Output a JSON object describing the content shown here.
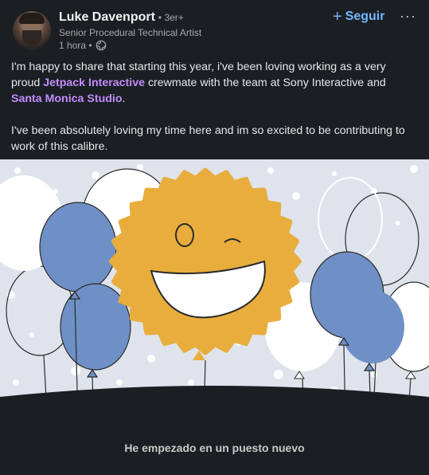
{
  "author": {
    "name": "Luke Davenport",
    "degree": "• 3er+",
    "headline": "Senior Procedural Technical Artist",
    "time": "1 hora •"
  },
  "actions": {
    "follow_label": "Seguir",
    "more_label": "···"
  },
  "post": {
    "p1": {
      "t1": "I'm happy to share that starting this year, i've been loving working as a very proud ",
      "m1": "Jetpack Interactive",
      "t2": " crewmate with the team at Sony Interactive and ",
      "m2": "Santa Monica Studio",
      "t3": "."
    },
    "p2": "I've been absolutely loving my time here and im so excited to be contributing to work of this calibre."
  },
  "image": {
    "caption": "He empezado en un puesto nuevo"
  },
  "colors": {
    "background": "#1b1f23",
    "link": "#71b7fb",
    "mention": "#c38bff",
    "sun": "#e8ad3d",
    "balloon_blue": "#6f90c6",
    "sky": "#dfe3ec"
  },
  "icons": {
    "globe": "globe-icon",
    "follow": "plus-icon",
    "more": "ellipsis-icon"
  }
}
